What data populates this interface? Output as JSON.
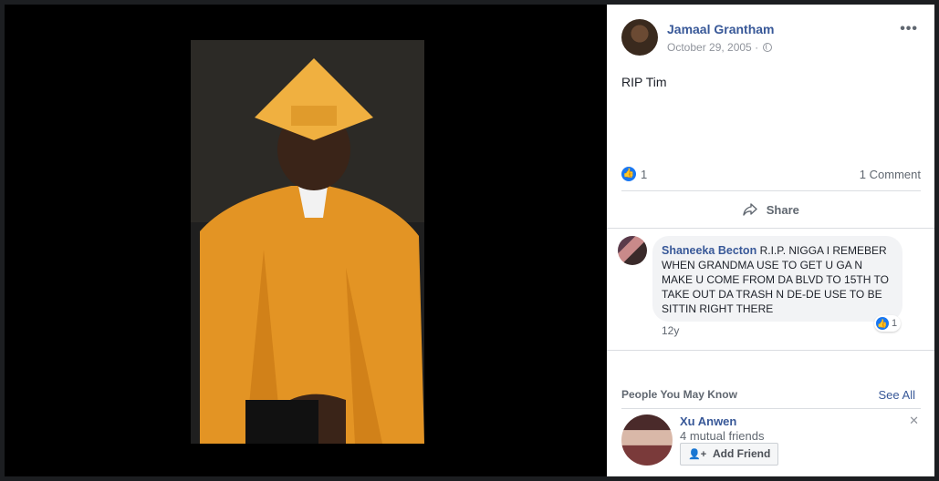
{
  "post": {
    "author": "Jamaal Grantham",
    "date": "October 29, 2005 ·",
    "text": "RIP Tim",
    "like_count": "1",
    "comment_count": "1 Comment",
    "share_label": "Share"
  },
  "comment": {
    "author": "Shaneeka Becton",
    "text": "R.I.P. NIGGA I REMEBER WHEN GRANDMA USE TO GET U GA N MAKE U COME FROM DA BLVD TO 15TH TO TAKE OUT DA TRASH N DE-DE USE TO BE SITTIN RIGHT THERE",
    "like_count": "1",
    "age": "12y"
  },
  "people_you_may_know": {
    "title": "People You May Know",
    "see_all": "See All",
    "suggestion": {
      "name": "Xu Anwen",
      "mutual": "4 mutual friends",
      "add_label": "Add Friend"
    }
  },
  "icons": [
    "more-icon",
    "globe-icon",
    "like-icon",
    "share-icon",
    "add-friend-icon",
    "close-icon"
  ],
  "colors": {
    "link": "#385898",
    "like": "#1877f2",
    "text": "#1d2129",
    "meta": "#606770"
  }
}
